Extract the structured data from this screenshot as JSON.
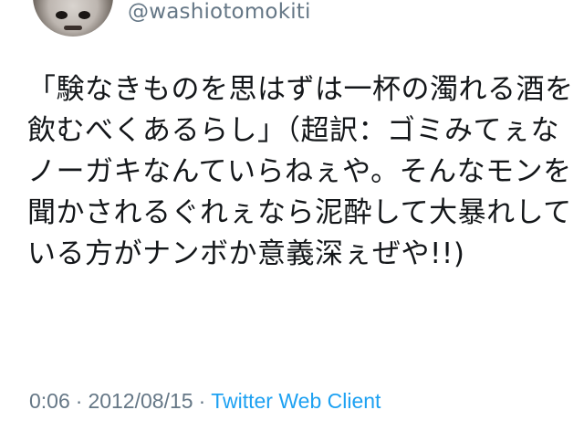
{
  "tweet": {
    "handle": "@washiotomokiti",
    "text": "「験なきものを思はずは一杯の濁れる酒を飲むべくあるらし」（超訳：ゴミみてぇなノーガキなんていらねぇや。そんなモンを聞かされるぐれぇなら泥酔して大暴れしている方がナンボか意義深ぇぜや!!)",
    "time": "0:06",
    "date": "2012/08/15",
    "separator": "·",
    "client": "Twitter Web Client"
  },
  "colors": {
    "text": "#14171a",
    "muted": "#657786",
    "link": "#1da1f2"
  },
  "icons": {
    "avatar": "user-avatar"
  }
}
